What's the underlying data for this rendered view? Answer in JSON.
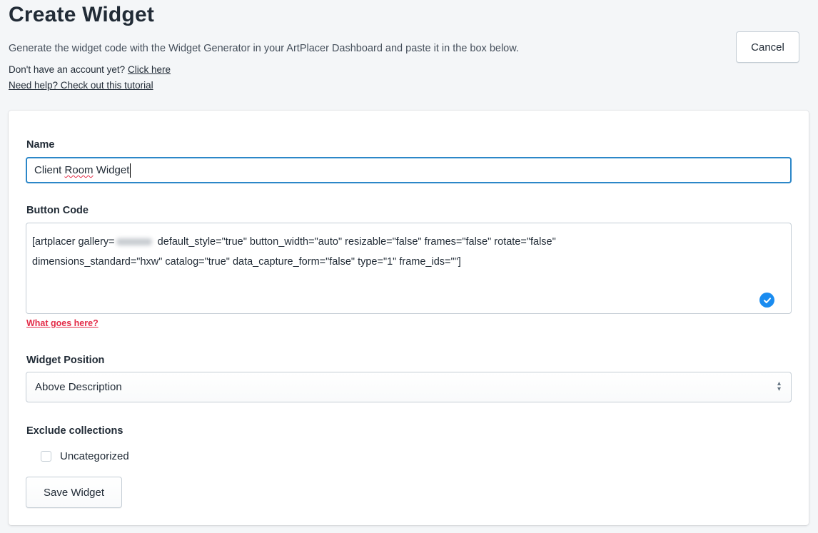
{
  "header": {
    "title": "Create Widget",
    "subtitle": "Generate the widget code with the Widget Generator in your ArtPlacer Dashboard and paste it in the box below.",
    "account_prompt": "Don't have an account yet?",
    "account_link": "Click here",
    "help_link": "Need help? Check out this tutorial",
    "cancel_label": "Cancel"
  },
  "form": {
    "name_label": "Name",
    "name_value_part1": "Client ",
    "name_value_part2": "Room",
    "name_value_part3": " Widget",
    "button_code_label": "Button Code",
    "code_prefix": "[artplacer gallery=",
    "code_suffix": " default_style=\"true\" button_width=\"auto\" resizable=\"false\" frames=\"false\" rotate=\"false\"",
    "code_line2": "dimensions_standard=\"hxw\" catalog=\"true\" data_capture_form=\"false\" type=\"1\" frame_ids=\"\"]",
    "what_goes_here": "What goes here?",
    "position_label": "Widget Position",
    "position_value": "Above Description",
    "exclude_label": "Exclude collections",
    "collections": [
      {
        "label": "Uncategorized",
        "checked": false
      }
    ],
    "save_label": "Save Widget"
  },
  "icons": {
    "valid": "check-circle-icon",
    "select": "select-arrows-icon"
  },
  "colors": {
    "accent": "#2c87c8",
    "valid_badge": "#1a8cf0",
    "error_link": "#e32c48"
  }
}
